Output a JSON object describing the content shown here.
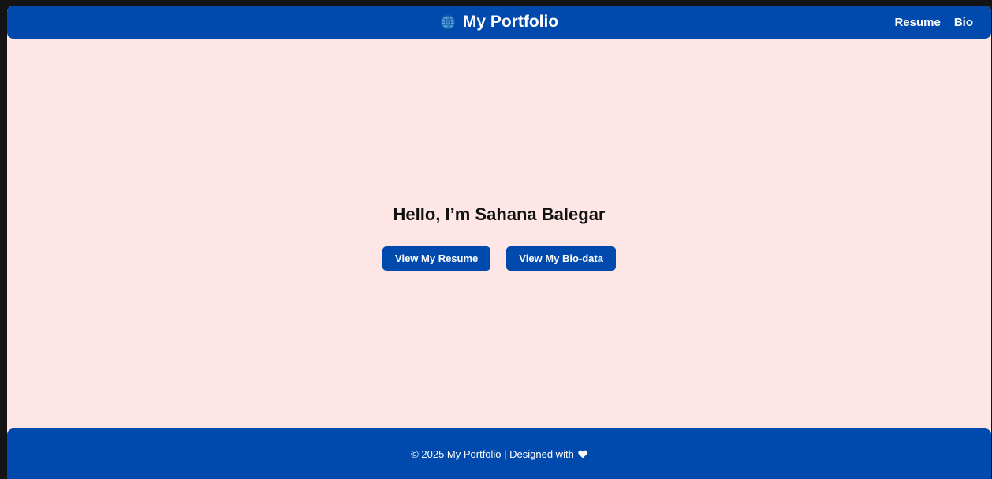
{
  "colors": {
    "primary": "#004aad",
    "background": "#ffe6e6",
    "text": "#111111",
    "on_primary": "#ffffff"
  },
  "navbar": {
    "brand_icon": "globe-icon",
    "brand_title": "My Portfolio",
    "links": [
      {
        "label": "Resume"
      },
      {
        "label": "Bio"
      }
    ]
  },
  "hero": {
    "title": "Hello, I’m Sahana Balegar",
    "buttons": [
      {
        "label": "View My Resume"
      },
      {
        "label": "View My Bio-data"
      }
    ]
  },
  "footer": {
    "text": "© 2025 My Portfolio | Designed with",
    "icon": "heart-icon"
  }
}
